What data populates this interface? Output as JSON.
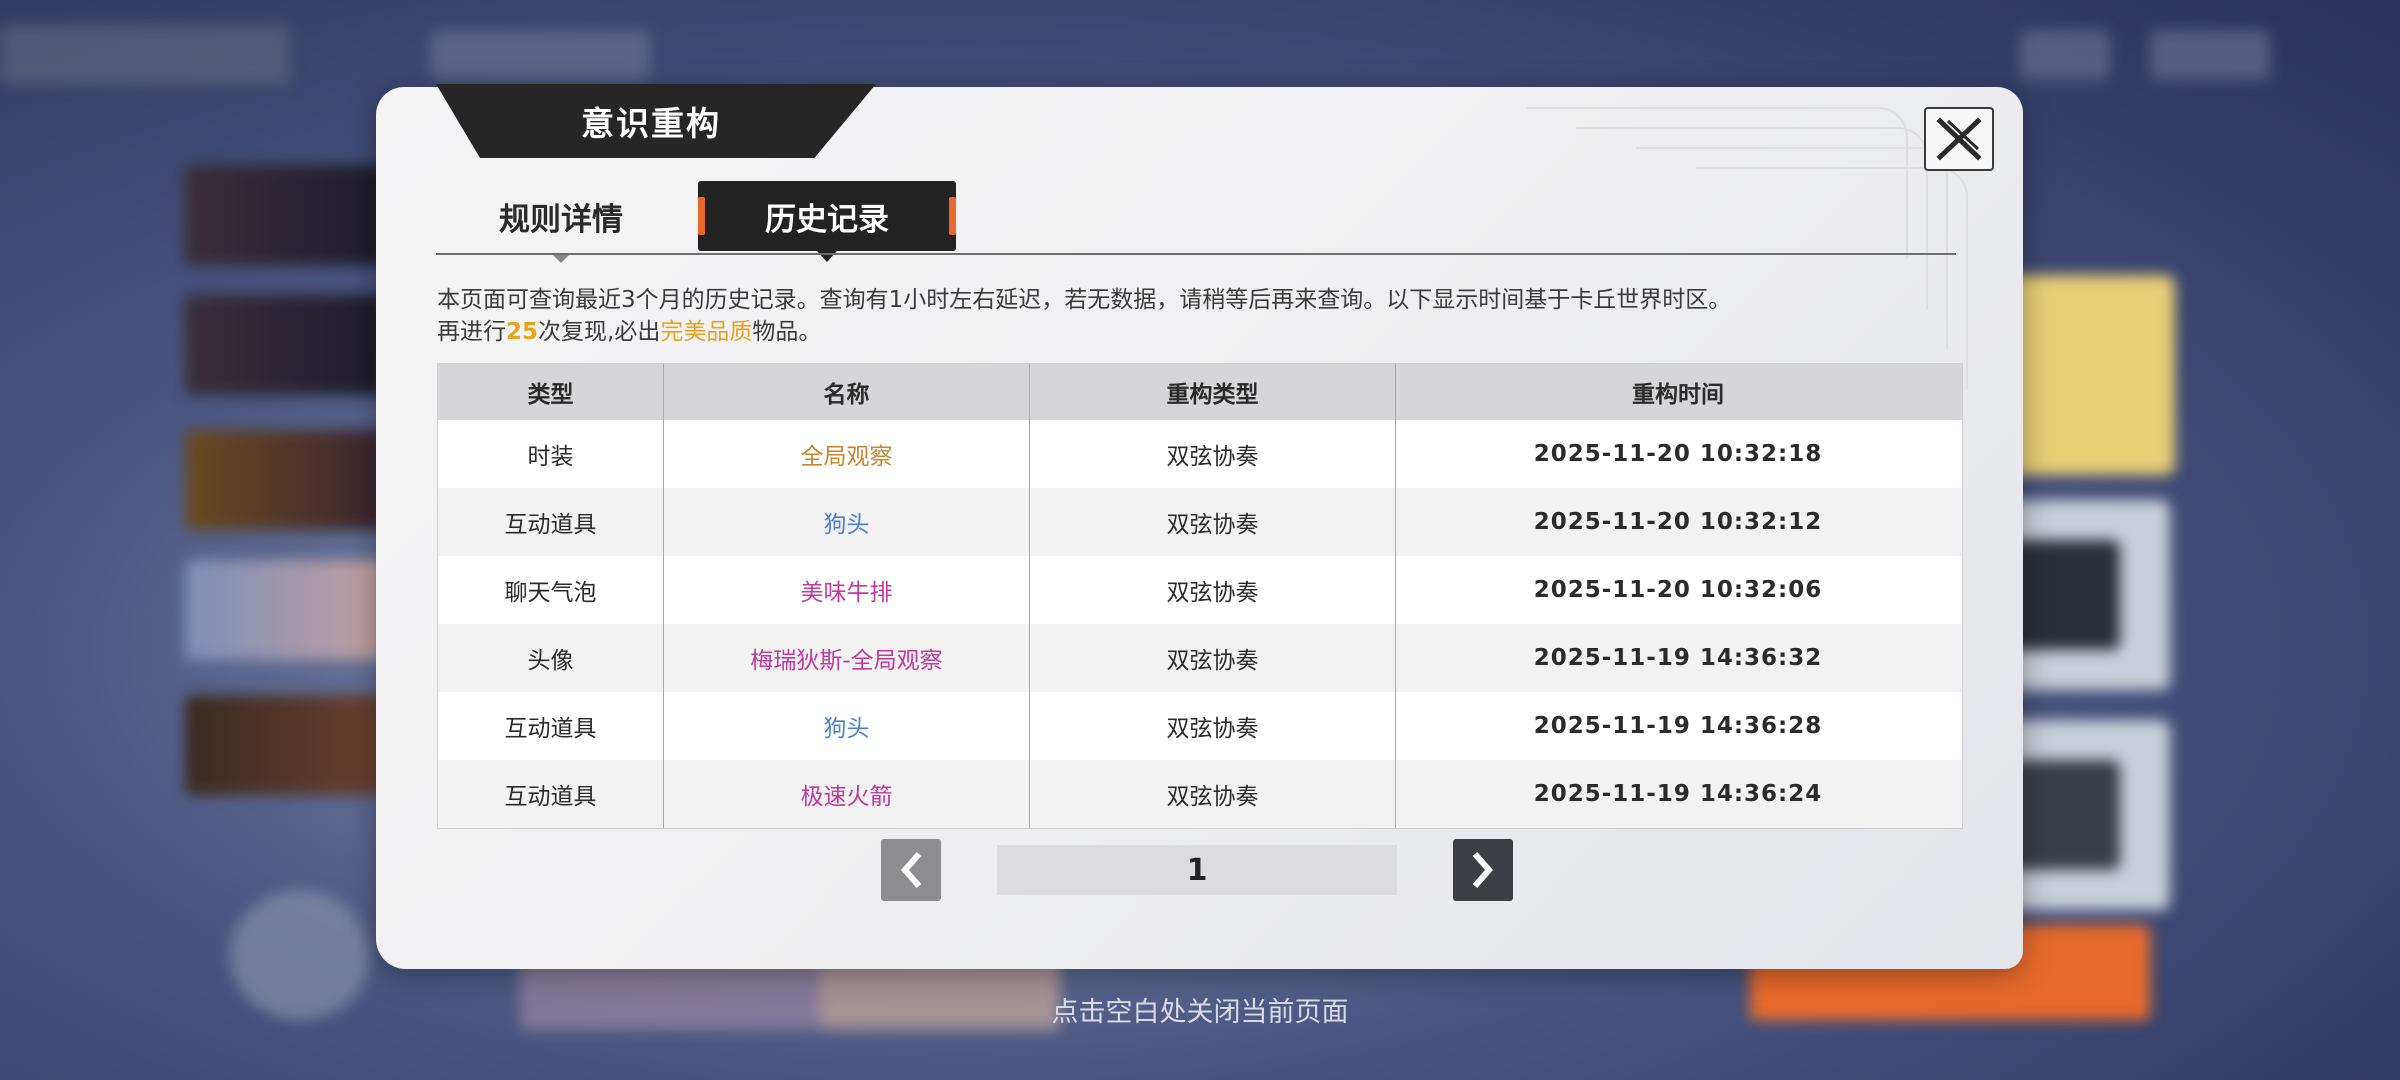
{
  "dialog": {
    "title": "意识重构",
    "tabs": [
      {
        "label": "规则详情",
        "active": false
      },
      {
        "label": "历史记录",
        "active": true
      }
    ],
    "notice": {
      "line1": "本页面可查询最近3个月的历史记录。查询有1小时左右延迟，若无数据，请稍等后再来查询。以下显示时间基于卡丘世界时区。",
      "line2_prefix": "再进行",
      "line2_count": "25",
      "line2_mid": "次复现,必出",
      "line2_quality": "完美品质",
      "line2_suffix": "物品。"
    },
    "table": {
      "headers": [
        "类型",
        "名称",
        "重构类型",
        "重构时间"
      ],
      "rows": [
        {
          "type": "时装",
          "name": "全局观察",
          "name_color": "#c9842c",
          "mode": "双弦协奏",
          "time": "2025-11-20   10:32:18"
        },
        {
          "type": "互动道具",
          "name": "狗头",
          "name_color": "#4a7fd6",
          "mode": "双弦协奏",
          "time": "2025-11-20   10:32:12"
        },
        {
          "type": "聊天气泡",
          "name": "美味牛排",
          "name_color": "#c2399e",
          "mode": "双弦协奏",
          "time": "2025-11-20   10:32:06"
        },
        {
          "type": "头像",
          "name": "梅瑞狄斯-全局观察",
          "name_color": "#c2399e",
          "mode": "双弦协奏",
          "time": "2025-11-19   14:36:32"
        },
        {
          "type": "互动道具",
          "name": "狗头",
          "name_color": "#4a7fd6",
          "mode": "双弦协奏",
          "time": "2025-11-19   14:36:28"
        },
        {
          "type": "互动道具",
          "name": "极速火箭",
          "name_color": "#c2399e",
          "mode": "双弦协奏",
          "time": "2025-11-19   14:36:24"
        }
      ]
    },
    "pagination": {
      "page": "1"
    },
    "icons": {
      "close": "close-icon",
      "prev": "chevron-left-icon",
      "next": "chevron-right-icon"
    }
  },
  "footer_hint": "点击空白处关闭当前页面",
  "colors": {
    "accent": "#e9a21c",
    "tab_edge": "#e7692b"
  }
}
